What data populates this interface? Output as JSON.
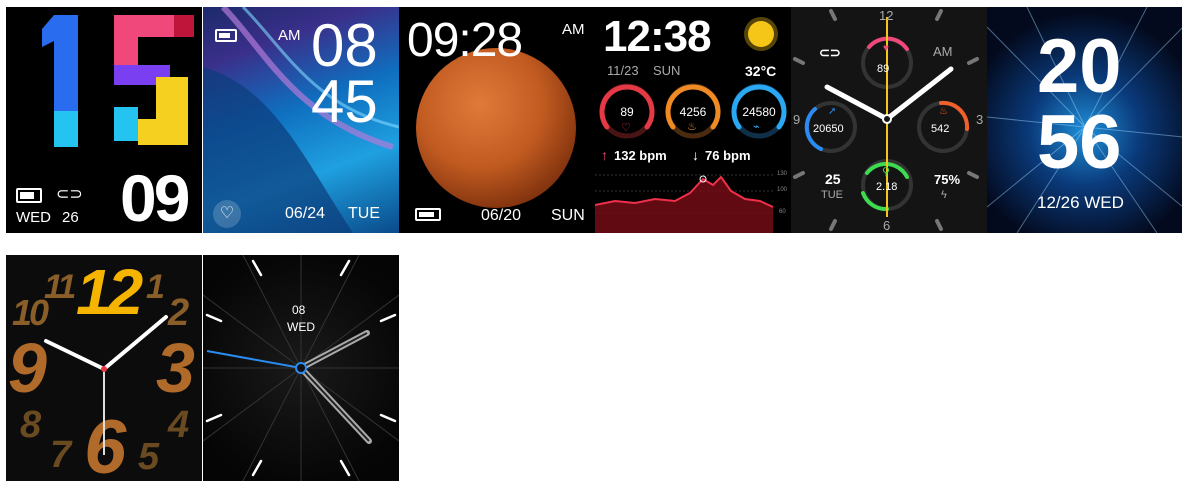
{
  "faces": [
    {
      "hour": "15",
      "minute": "09",
      "day": "WED",
      "date": "26"
    },
    {
      "ampm": "AM",
      "hour": "08",
      "minute": "45",
      "date": "06/24",
      "day": "TUE"
    },
    {
      "time": "09:28",
      "ampm": "AM",
      "date": "06/20",
      "day": "SUN"
    },
    {
      "time": "12:38",
      "date": "11/23",
      "day": "SUN",
      "temp": "32°C",
      "rings": [
        {
          "value": "89",
          "color": "#e63946"
        },
        {
          "value": "4256",
          "color": "#f08a24"
        },
        {
          "value": "24580",
          "color": "#2aa8f2"
        }
      ],
      "max_bpm": "132 bpm",
      "min_bpm": "76 bpm",
      "chart_ticks": [
        "130",
        "100",
        "60"
      ]
    },
    {
      "n12": "12",
      "n3": "3",
      "n6": "6",
      "n9": "9",
      "ampm": "AM",
      "top": "89",
      "left": "20650",
      "right": "542",
      "bottom": "2.18",
      "date_num": "25",
      "date_day": "TUE",
      "battery": "75%"
    },
    {
      "hour": "20",
      "minute": "56",
      "date": "12/26 WED"
    },
    {
      "numbers": [
        "12",
        "1",
        "2",
        "3",
        "4",
        "5",
        "6",
        "7",
        "8",
        "9",
        "10",
        "11"
      ]
    },
    {
      "date": "08",
      "day": "WED"
    }
  ],
  "colors": {
    "accent_red": "#e63946",
    "accent_orange": "#f08a24",
    "accent_blue": "#2aa8f2",
    "accent_green": "#3ddc4f",
    "accent_pink": "#f0487a",
    "accent_yellow": "#f5c518"
  }
}
